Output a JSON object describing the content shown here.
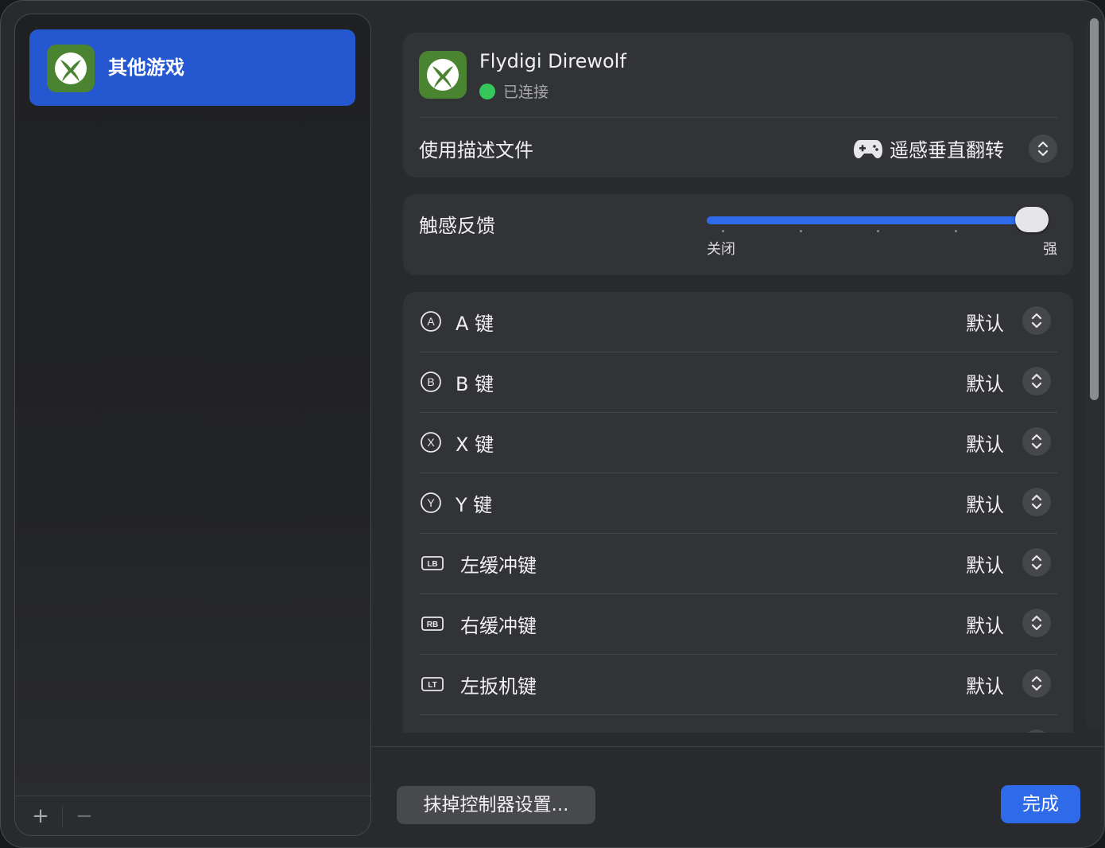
{
  "sidebar": {
    "items": [
      {
        "label": "其他游戏",
        "icon": "xbox-logo-icon",
        "selected": true
      }
    ],
    "add_label": "+",
    "remove_label": "−"
  },
  "device": {
    "name": "Flydigi Direwolf",
    "status": "已连接",
    "status_color": "#35c759",
    "icon": "xbox-logo-icon",
    "profile_label": "使用描述文件",
    "profile_value": "遥感垂直翻转",
    "profile_icon": "gamepad-icon"
  },
  "haptics": {
    "label": "触感反馈",
    "min_label": "关闭",
    "max_label": "强",
    "level": 1.0,
    "steps": 5
  },
  "buttons": [
    {
      "glyph": "A",
      "glyph_shape": "circle",
      "label": "A 键",
      "value": "默认"
    },
    {
      "glyph": "B",
      "glyph_shape": "circle",
      "label": "B 键",
      "value": "默认"
    },
    {
      "glyph": "X",
      "glyph_shape": "circle",
      "label": "X 键",
      "value": "默认"
    },
    {
      "glyph": "Y",
      "glyph_shape": "circle",
      "label": "Y 键",
      "value": "默认"
    },
    {
      "glyph": "LB",
      "glyph_shape": "rect",
      "label": "左缓冲键",
      "value": "默认"
    },
    {
      "glyph": "RB",
      "glyph_shape": "rect",
      "label": "右缓冲键",
      "value": "默认"
    },
    {
      "glyph": "LT",
      "glyph_shape": "rect",
      "label": "左扳机键",
      "value": "默认"
    }
  ],
  "footer": {
    "reset_label": "抹掉控制器设置...",
    "done_label": "完成"
  },
  "colors": {
    "accent": "#2f6be8",
    "sidebar_selected": "#2558d0",
    "xbox_green": "#4a8430"
  }
}
